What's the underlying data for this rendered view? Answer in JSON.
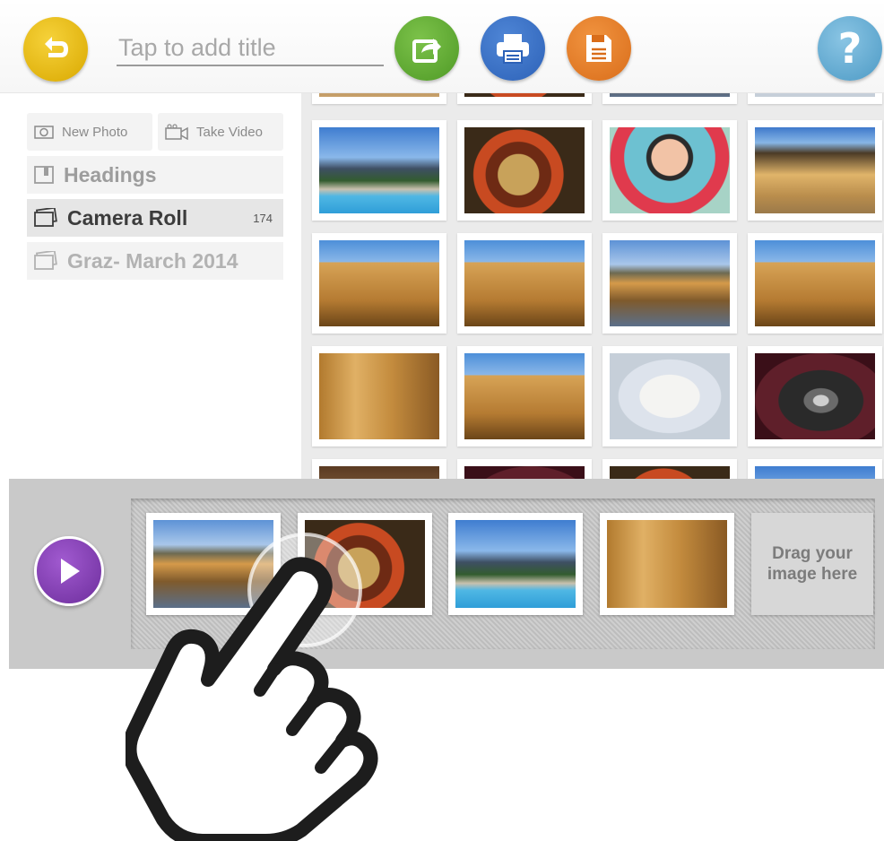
{
  "toolbar": {
    "title_placeholder": "Tap to add title",
    "buttons": [
      {
        "name": "back",
        "icon": "back-arrow-icon",
        "color": "#e3b40d"
      },
      {
        "name": "share",
        "icon": "share-icon",
        "color": "#5fae31"
      },
      {
        "name": "print",
        "icon": "printer-icon",
        "color": "#3a70c5"
      },
      {
        "name": "save",
        "icon": "save-icon",
        "color": "#e77d24"
      },
      {
        "name": "help",
        "icon": "help-icon",
        "label": "?",
        "color": "#62aad2"
      }
    ]
  },
  "sidebar": {
    "new_photo": "New Photo",
    "take_video": "Take Video",
    "items": [
      {
        "label": "Headings",
        "icon": "heading-icon",
        "selected": false
      },
      {
        "label": "Camera Roll",
        "icon": "album-icon",
        "count": "174",
        "selected": true
      },
      {
        "label": "Graz- March 2014",
        "icon": "album-icon",
        "selected": false
      }
    ]
  },
  "grid": {
    "photos": [
      "pool",
      "food",
      "baby",
      "cliff",
      "building-sky",
      "building-sky",
      "town-sea",
      "building-sky",
      "building",
      "building-sky",
      "notes",
      "ultra"
    ]
  },
  "filmstrip": {
    "play_icon": "play-icon",
    "items": [
      "town-sea",
      "food",
      "pool",
      "building"
    ],
    "drop_zone_text": "Drag your image here"
  },
  "overlay": {
    "icon": "hand-pointer-icon"
  }
}
